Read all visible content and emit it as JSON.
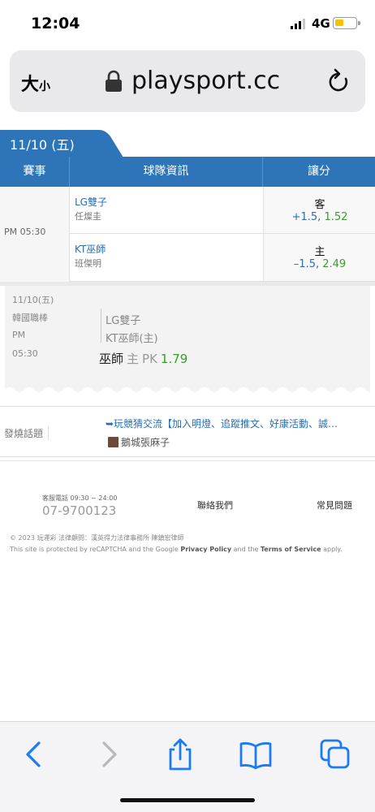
{
  "status_bar": {
    "time": "12:04",
    "network": "4G",
    "signal_icon": "cellular-signal-icon",
    "battery_icon": "battery-low-icon"
  },
  "url_bar": {
    "text_size_label": "大",
    "text_size_small": "小",
    "url": "playsport.cc",
    "lock_icon": "lock-icon",
    "reload_icon": "reload-icon"
  },
  "date_tab": {
    "label": "11/10 (五)"
  },
  "table_header": {
    "col1": "賽事",
    "col2": "球隊資訊",
    "col3": "讓分"
  },
  "game": {
    "time": "PM 05:30",
    "rows": [
      {
        "team": "LG雙子",
        "pitcher": "任燦圭",
        "side": "客",
        "line": "+1.5",
        "price": "1.52"
      },
      {
        "team": "KT巫師",
        "pitcher": "班傑明",
        "side": "主",
        "line": "–1.5",
        "price": "2.49"
      }
    ]
  },
  "ticket": {
    "date": "11/10(五)",
    "league": "韓國職棒",
    "ampm": "PM",
    "time": "05:30",
    "team1": "LG雙子",
    "team2": "KT巫師(主)",
    "pick_team": "巫師",
    "pick_side": "主",
    "pick_type": "PK",
    "pick_price": "1.79"
  },
  "hot_topic": {
    "label": "發燒話題",
    "topic": "➥玩競猜交流【加入明燈、追蹤推文、好康活動、誠…",
    "author": "鵝城張麻子"
  },
  "footer": {
    "hours": "客服電話 09:30 ~ 24:00",
    "phone": "07-9700123",
    "contact": "聯絡我們",
    "faq": "常見問題",
    "copyright": "© 2023 玩運彩  法律顧問：漢英得力法律事務所 陳鎮宏律師",
    "recaptcha_pre": "This site is protected by reCAPTCHA and the Google ",
    "privacy": "Privacy Policy",
    "and": " and the ",
    "terms": "Terms of Service",
    "recaptcha_post": " apply."
  },
  "toolbar": {
    "back_icon": "back-chevron-icon",
    "forward_icon": "forward-chevron-icon",
    "share_icon": "share-icon",
    "bookmarks_icon": "book-icon",
    "tabs_icon": "tabs-icon"
  },
  "colors": {
    "accent": "#2e74b8",
    "link": "#2a6fb5",
    "price": "#3a9a2e",
    "ios_blue": "#1a7cf0"
  }
}
